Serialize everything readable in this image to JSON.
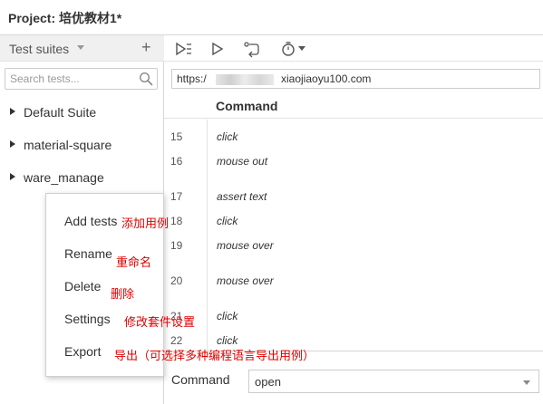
{
  "window": {
    "title": "Project:  培优教材1*"
  },
  "sidebar": {
    "title": "Test suites",
    "search_placeholder": "Search tests...",
    "suites": [
      "Default Suite",
      "material-square",
      "ware_manage"
    ]
  },
  "context_menu": {
    "items": [
      "Add tests",
      "Rename",
      "Delete",
      "Settings",
      "Export"
    ]
  },
  "annotations": {
    "add": "添加用例",
    "rename": "重命名",
    "delete": "删除",
    "settings": "修改套件设置",
    "export": "导出（可选择多种编程语言导出用例）"
  },
  "toolbar": {
    "icons": [
      "run-all-icon",
      "run-icon",
      "record-icon",
      "timer-icon"
    ]
  },
  "url_bar": {
    "prefix": "https:/",
    "suffix": "xiaojiaoyu100.com"
  },
  "grid": {
    "column_header": "Command",
    "rows": [
      {
        "num": "15",
        "cmd": "click"
      },
      {
        "num": "16",
        "cmd": "mouse out"
      },
      {
        "num": "17",
        "cmd": "assert text"
      },
      {
        "num": "18",
        "cmd": "click"
      },
      {
        "num": "19",
        "cmd": "mouse over"
      },
      {
        "num": "20",
        "cmd": "mouse over"
      },
      {
        "num": "21",
        "cmd": "click"
      },
      {
        "num": "22",
        "cmd": "click"
      }
    ]
  },
  "editor": {
    "command_label": "Command",
    "command_value": "open"
  },
  "colors": {
    "annotation": "#e00000",
    "border": "#d6d6d6"
  }
}
